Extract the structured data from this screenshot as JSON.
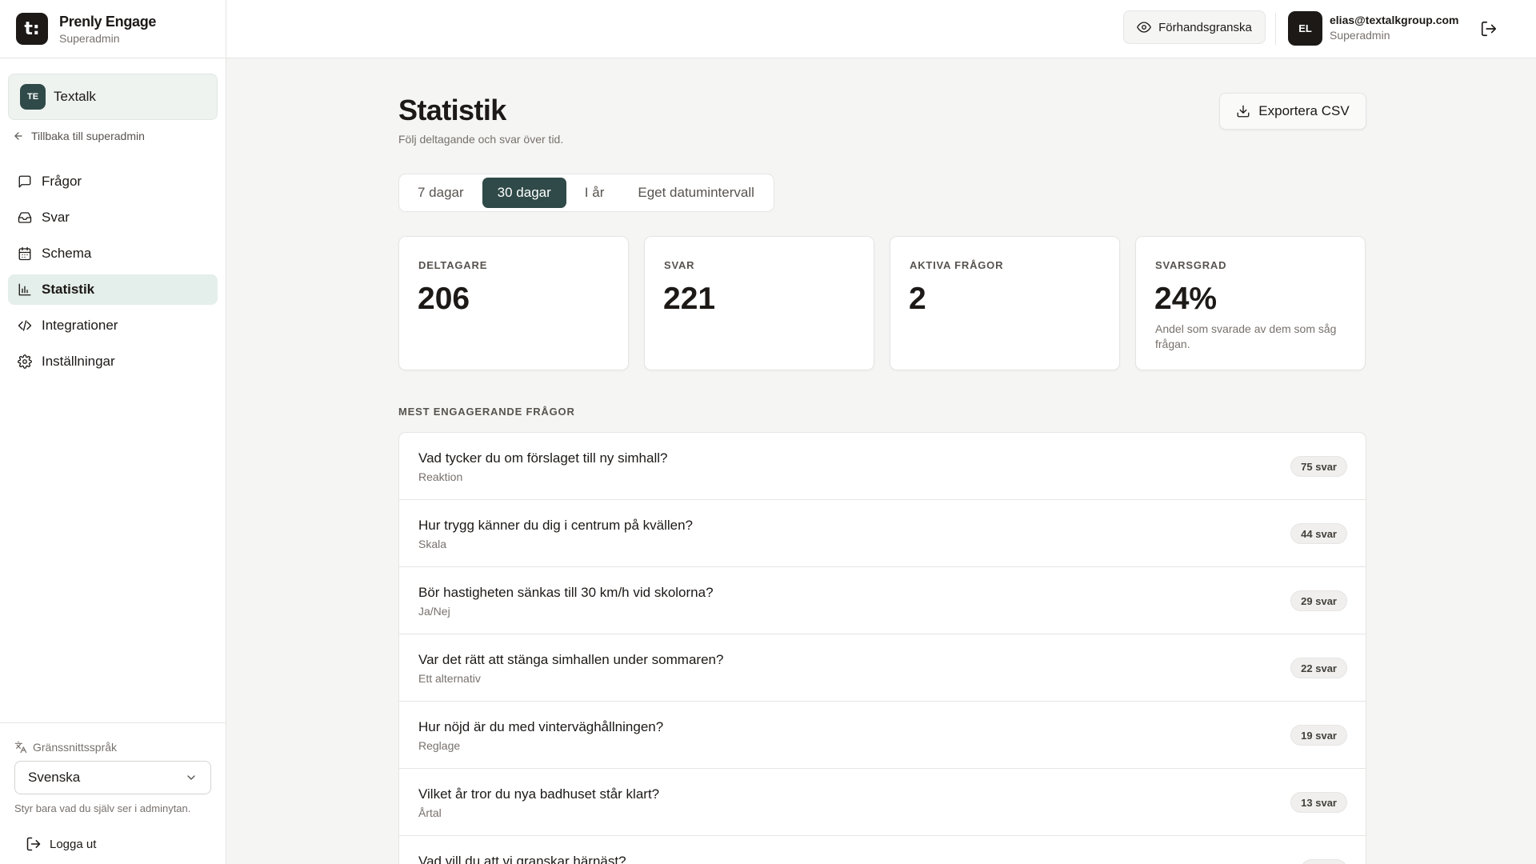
{
  "brand": {
    "name": "Prenly Engage",
    "role": "Superadmin",
    "logo_glyph": "t:"
  },
  "org": {
    "initials": "TE",
    "name": "Textalk"
  },
  "back_link": "Tillbaka till superadmin",
  "nav": [
    {
      "label": "Frågor",
      "icon": "message-square-icon",
      "active": false
    },
    {
      "label": "Svar",
      "icon": "inbox-icon",
      "active": false
    },
    {
      "label": "Schema",
      "icon": "calendar-icon",
      "active": false
    },
    {
      "label": "Statistik",
      "icon": "bar-chart-icon",
      "active": true
    },
    {
      "label": "Integrationer",
      "icon": "code-icon",
      "active": false
    },
    {
      "label": "Inställningar",
      "icon": "gear-icon",
      "active": false
    }
  ],
  "language": {
    "label": "Gränssnittsspråk",
    "selected": "Svenska",
    "hint": "Styr bara vad du själv ser i adminytan."
  },
  "logout_label": "Logga ut",
  "topbar": {
    "preview_label": "Förhandsgranska",
    "user_initials": "EL",
    "user_email": "elias@textalkgroup.com",
    "user_role": "Superadmin"
  },
  "page": {
    "title": "Statistik",
    "subtitle": "Följ deltagande och svar över tid.",
    "export_label": "Exportera CSV"
  },
  "periods": [
    {
      "label": "7 dagar",
      "active": false
    },
    {
      "label": "30 dagar",
      "active": true
    },
    {
      "label": "I år",
      "active": false
    },
    {
      "label": "Eget datumintervall",
      "active": false
    }
  ],
  "stats": [
    {
      "label": "DELTAGARE",
      "value": "206",
      "desc": ""
    },
    {
      "label": "SVAR",
      "value": "221",
      "desc": ""
    },
    {
      "label": "AKTIVA FRÅGOR",
      "value": "2",
      "desc": ""
    },
    {
      "label": "SVARSGRAD",
      "value": "24%",
      "desc": "Andel som svarade av dem som såg frågan."
    }
  ],
  "section_title": "MEST ENGAGERANDE FRÅGOR",
  "questions": [
    {
      "title": "Vad tycker du om förslaget till ny simhall?",
      "type": "Reaktion",
      "count": "75 svar"
    },
    {
      "title": "Hur trygg känner du dig i centrum på kvällen?",
      "type": "Skala",
      "count": "44 svar"
    },
    {
      "title": "Bör hastigheten sänkas till 30 km/h vid skolorna?",
      "type": "Ja/Nej",
      "count": "29 svar"
    },
    {
      "title": "Var det rätt att stänga simhallen under sommaren?",
      "type": "Ett alternativ",
      "count": "22 svar"
    },
    {
      "title": "Hur nöjd är du med vinterväghållningen?",
      "type": "Reglage",
      "count": "19 svar"
    },
    {
      "title": "Vilket år tror du nya badhuset står klart?",
      "type": "Årtal",
      "count": "13 svar"
    },
    {
      "title": "Vad vill du att vi granskar härnäst?",
      "type": "",
      "count": ""
    }
  ],
  "colors": {
    "accent": "#2f4a48",
    "active_nav_bg": "#e4eeea",
    "page_bg": "#f5f5f4"
  }
}
